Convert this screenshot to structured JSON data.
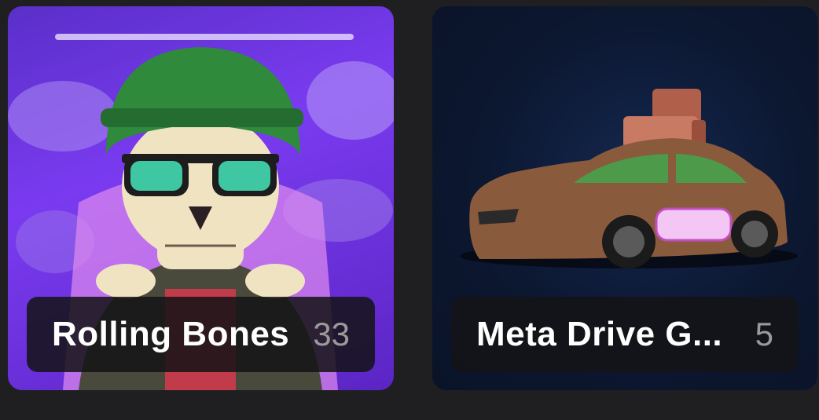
{
  "collections": [
    {
      "name": "Rolling Bones",
      "count": "33",
      "art_icon": "skull-helmet-art"
    },
    {
      "name": "Meta Drive G...",
      "count": "5",
      "art_icon": "car-armchair-art"
    }
  ],
  "colors": {
    "background": "#1f1f21",
    "label_bg": "#141416",
    "count_text": "#9a9a9a"
  }
}
